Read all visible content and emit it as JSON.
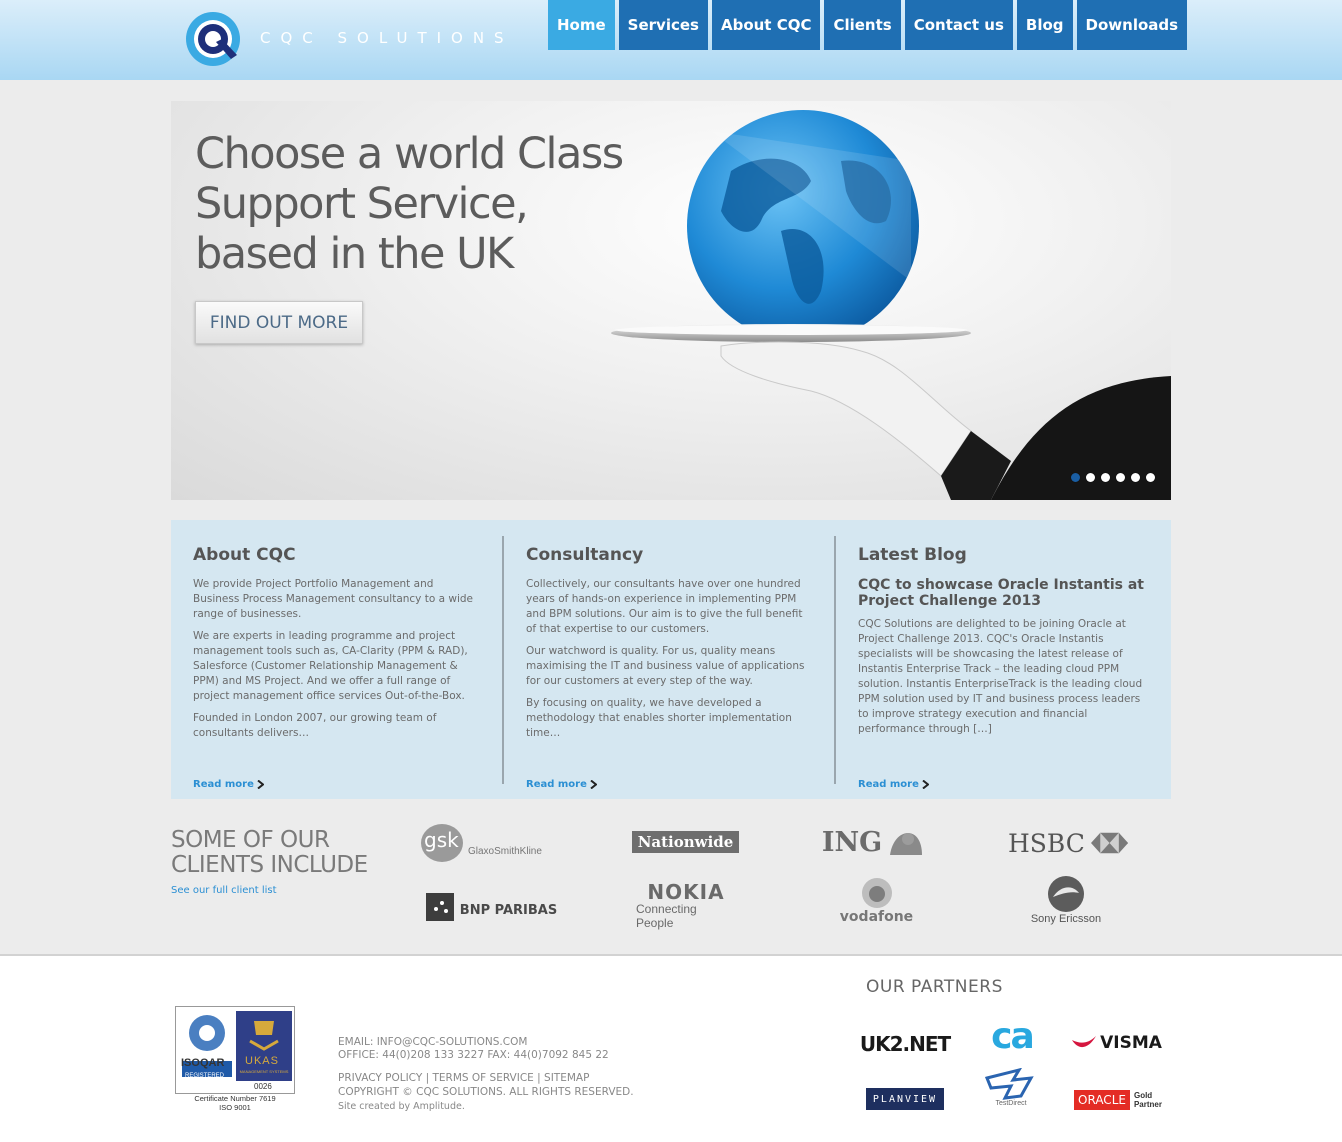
{
  "header": {
    "brand": "CQC SOLUTIONS",
    "nav": [
      "Home",
      "Services",
      "About CQC",
      "Clients",
      "Contact us",
      "Blog",
      "Downloads"
    ],
    "active_nav": "Home"
  },
  "hero": {
    "heading": "Choose a world Class Support Service, based in the UK",
    "cta": "FIND OUT MORE",
    "slide_count": 6,
    "active_slide": 1
  },
  "columns": {
    "about": {
      "title": "About CQC",
      "p1": "We provide Project Portfolio Management and Business Process Management consultancy to a wide range of businesses.",
      "p2": "We are experts in leading programme and project management tools such as, CA-Clarity (PPM & RAD), Salesforce (Customer Relationship Management & PPM) and MS Project. And we offer a full range of project management office services Out-of-the-Box.",
      "p3": "Founded in London 2007, our growing team of consultants delivers…",
      "read_more": "Read more"
    },
    "consultancy": {
      "title": "Consultancy",
      "p1": "Collectively, our consultants have over one hundred years of hands-on experience in implementing PPM and BPM solutions. Our aim is to give the full benefit of that expertise to our customers.",
      "p2": "Our watchword is quality. For us, quality means maximising the IT and business value of applications for our customers at every step of the way.",
      "p3": "By focusing on quality, we have developed a methodology that enables shorter implementation time…",
      "read_more": "Read more"
    },
    "blog": {
      "title": "Latest Blog",
      "post_title": "CQC to showcase Oracle Instantis at Project Challenge 2013",
      "p1": "CQC Solutions are delighted to be joining Oracle at Project Challenge 2013. CQC's Oracle Instantis specialists will be showcasing the latest release of Instantis Enterprise Track – the leading cloud PPM solution. Instantis EnterpriseTrack is the leading cloud PPM solution used by IT and business process leaders to improve strategy execution and financial performance through […]",
      "read_more": "Read more"
    }
  },
  "clients": {
    "heading": "SOME OF OUR CLIENTS INCLUDE",
    "link": "See our full client list",
    "logos": [
      "gsk",
      "GlaxoSmithKline",
      "Nationwide",
      "ING",
      "HSBC",
      "BNP PARIBAS",
      "NOKIA",
      "Connecting People",
      "vodafone",
      "Sony Ericsson"
    ]
  },
  "footer": {
    "cert_brand": "ISOQAR",
    "cert_registered": "REGISTERED",
    "cert_ukas": "UKAS",
    "cert_ukas_sub": "MANAGEMENT SYSTEMS",
    "cert_code": "0026",
    "cert_number": "Certificate Number 7619",
    "cert_iso": "ISO 9001",
    "email": "EMAIL: INFO@CQC-SOLUTIONS.COM",
    "office": "OFFICE: 44(0)208 133 3227   FAX: 44(0)7092 845 22",
    "privacy": "PRIVACY POLICY",
    "terms": "TERMS OF SERVICE",
    "sitemap": "SITEMAP",
    "separator": "|",
    "copyright": "COPYRIGHT © CQC SOLUTIONS. ALL RIGHTS RESERVED.",
    "credit": "Site created by Amplitude.",
    "partners_title": "OUR PARTNERS",
    "partners": [
      "UK2.NET",
      "ca",
      "VISMA",
      "PLANVIEW",
      "TestDirect",
      "ORACLE",
      "Gold",
      "Partner"
    ]
  },
  "colors": {
    "nav_bg": "#1f6fb3",
    "nav_active": "#3aaae3",
    "content_bg": "#d5e7f1",
    "link": "#2b8fd3"
  }
}
